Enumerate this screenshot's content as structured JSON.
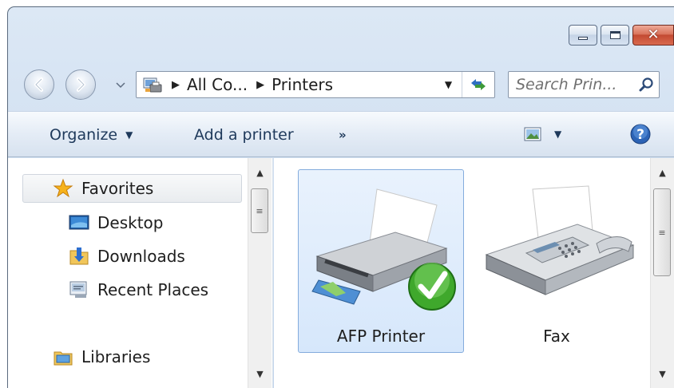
{
  "window": {
    "caption_buttons": {
      "minimize": "minimize",
      "maximize": "maximize",
      "close": "✕"
    }
  },
  "navigation": {
    "breadcrumbs": [
      "All Co...",
      "Printers"
    ],
    "search_placeholder": "Search Prin..."
  },
  "command_bar": {
    "organize": "Organize",
    "add_printer": "Add a printer",
    "more": "»"
  },
  "nav_pane": {
    "favorites": "Favorites",
    "items": [
      "Desktop",
      "Downloads",
      "Recent Places"
    ],
    "libraries": "Libraries"
  },
  "devices": [
    {
      "label": "AFP Printer",
      "icon": "printer-icon",
      "default": true,
      "selected": true
    },
    {
      "label": "Fax",
      "icon": "fax-icon",
      "default": false,
      "selected": false
    }
  ],
  "colors": {
    "selection_fill": "#d6e7fb",
    "selection_border": "#84acdd",
    "close_button": "#c34a32",
    "default_check": "#3fa82c"
  }
}
